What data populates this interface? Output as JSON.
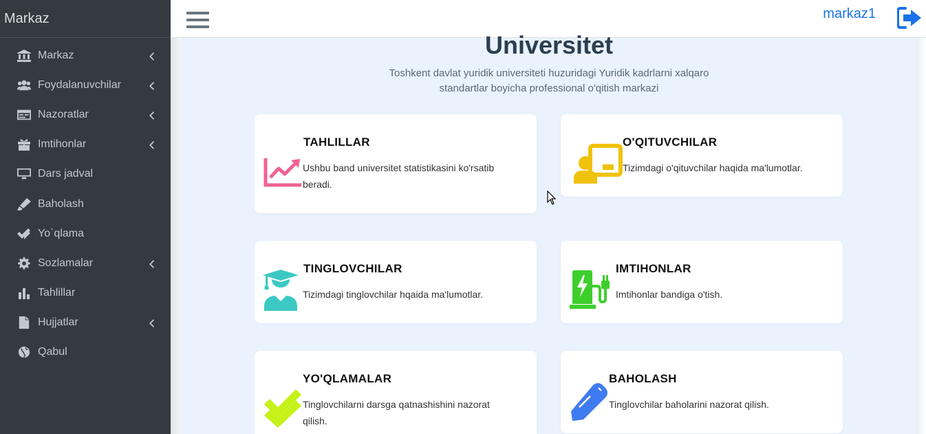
{
  "sidebar": {
    "brand": "Markaz",
    "items": [
      {
        "label": "Markaz",
        "icon": "university-icon"
      },
      {
        "label": "Foydalanuvchilar",
        "icon": "users-icon"
      },
      {
        "label": "Nazoratlar",
        "icon": "id-card-icon"
      },
      {
        "label": "Imtihonlar",
        "icon": "gift-icon"
      },
      {
        "label": "Dars jadval",
        "icon": "desktop-icon"
      },
      {
        "label": "Baholash",
        "icon": "marker-icon"
      },
      {
        "label": "Yo`qlama",
        "icon": "double-check-icon"
      },
      {
        "label": "Sozlamalar",
        "icon": "gear-icon"
      },
      {
        "label": "Tahlillar",
        "icon": "bar-chart-icon"
      },
      {
        "label": "Hujjatlar",
        "icon": "file-icon"
      },
      {
        "label": "Qabul",
        "icon": "globe-icon"
      }
    ]
  },
  "header": {
    "username": "markaz1"
  },
  "main": {
    "title": "Universitet",
    "subtitle": "Toshkent davlat yuridik universiteti huzuridagi Yuridik kadrlarni xalqaro standartlar boyicha professional o'qitish markazi",
    "cards": [
      {
        "title": "TAHLILLAR",
        "desc": "Ushbu band universitet statistikasini ko'rsatib beradi.",
        "icon": "trend-chart-icon",
        "color": "#f06292"
      },
      {
        "title": "O'QITUVCHILAR",
        "desc": "Tizimdagi o'qituvchilar haqida ma'lumotlar.",
        "icon": "teacher-board-icon",
        "color": "#f0c20c"
      },
      {
        "title": "TINGLOVCHILAR",
        "desc": "Tizimdagi tinglovchilar hqaida ma'lumotlar.",
        "icon": "graduate-icon",
        "color": "#3cc9c3"
      },
      {
        "title": "IMTIHONLAR",
        "desc": "Imtihonlar bandiga o'tish.",
        "icon": "charging-station-icon",
        "color": "#3ecf2c"
      },
      {
        "title": "YO'QLAMALAR",
        "desc": "Tinglovchilarni darsga qatnashishini nazorat qilish.",
        "icon": "double-check-icon",
        "color": "#c6f21a"
      },
      {
        "title": "BAHOLASH",
        "desc": "Tinglovchilar baholarini nazorat qilish.",
        "icon": "pen-icon",
        "color": "#3f7bf0"
      }
    ]
  },
  "colors": {
    "sidebar_bg": "#343a40",
    "accent": "#1a73e8",
    "content_bg": "#eaf2fd"
  }
}
